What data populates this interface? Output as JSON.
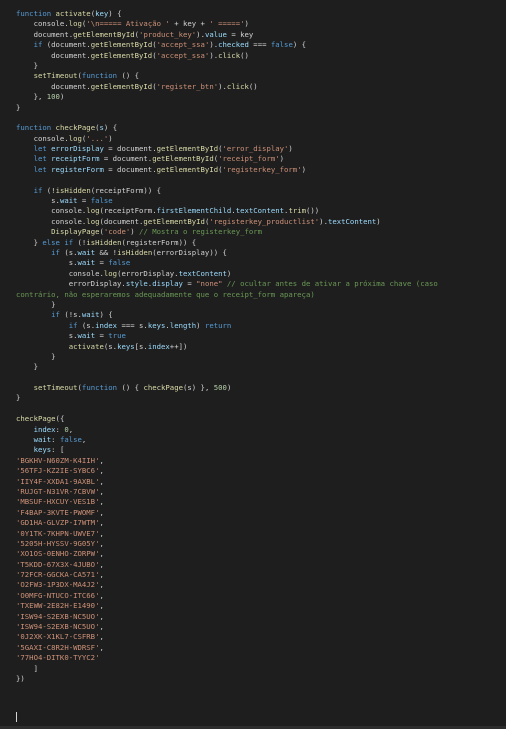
{
  "editor": {
    "language": "javascript",
    "colors": {
      "background": "#1e1e1e",
      "keyword": "#569cd6",
      "function": "#dcdcaa",
      "string": "#ce9178",
      "variable": "#9cdcfe",
      "number": "#b5cea8",
      "comment": "#6a9955",
      "plain": "#d4d4d4"
    },
    "lines": [
      [
        [
          "kw",
          "function "
        ],
        [
          "fn",
          "activate"
        ],
        [
          "pun",
          "("
        ],
        [
          "var",
          "key"
        ],
        [
          "pun",
          ") {"
        ]
      ],
      [
        [
          "plain",
          "    console."
        ],
        [
          "fn",
          "log"
        ],
        [
          "pun",
          "("
        ],
        [
          "str",
          "'\\n===== Ativação '"
        ],
        [
          "pun",
          " + key + "
        ],
        [
          "str",
          "' ====='"
        ],
        [
          "pun",
          ")"
        ]
      ],
      [
        [
          "plain",
          "    document."
        ],
        [
          "fn",
          "getElementById"
        ],
        [
          "pun",
          "("
        ],
        [
          "str",
          "'product_key'"
        ],
        [
          "pun",
          ")."
        ],
        [
          "var",
          "value"
        ],
        [
          "pun",
          " = key"
        ]
      ],
      [
        [
          "kw",
          "    if "
        ],
        [
          "pun",
          "(document."
        ],
        [
          "fn",
          "getElementById"
        ],
        [
          "pun",
          "("
        ],
        [
          "str",
          "'accept_ssa'"
        ],
        [
          "pun",
          ")."
        ],
        [
          "var",
          "checked"
        ],
        [
          "pun",
          " === "
        ],
        [
          "kw",
          "false"
        ],
        [
          "pun",
          ") {"
        ]
      ],
      [
        [
          "plain",
          "        document."
        ],
        [
          "fn",
          "getElementById"
        ],
        [
          "pun",
          "("
        ],
        [
          "str",
          "'accept_ssa'"
        ],
        [
          "pun",
          ")."
        ],
        [
          "fn",
          "click"
        ],
        [
          "pun",
          "()"
        ]
      ],
      [
        [
          "pun",
          "    }"
        ]
      ],
      [
        [
          "plain",
          "    "
        ],
        [
          "fn",
          "setTimeout"
        ],
        [
          "pun",
          "("
        ],
        [
          "kw",
          "function"
        ],
        [
          "pun",
          " () {"
        ]
      ],
      [
        [
          "plain",
          "        document."
        ],
        [
          "fn",
          "getElementById"
        ],
        [
          "pun",
          "("
        ],
        [
          "str",
          "'register_btn'"
        ],
        [
          "pun",
          ")."
        ],
        [
          "fn",
          "click"
        ],
        [
          "pun",
          "()"
        ]
      ],
      [
        [
          "pun",
          "    }, "
        ],
        [
          "num",
          "100"
        ],
        [
          "pun",
          ")"
        ]
      ],
      [
        [
          "pun",
          "}"
        ]
      ],
      [
        [
          "plain",
          ""
        ]
      ],
      [
        [
          "kw",
          "function "
        ],
        [
          "fn",
          "checkPage"
        ],
        [
          "pun",
          "("
        ],
        [
          "var",
          "s"
        ],
        [
          "pun",
          ") {"
        ]
      ],
      [
        [
          "plain",
          "    console."
        ],
        [
          "fn",
          "log"
        ],
        [
          "pun",
          "("
        ],
        [
          "str",
          "'...'"
        ],
        [
          "pun",
          ")"
        ]
      ],
      [
        [
          "kw",
          "    let "
        ],
        [
          "var",
          "errorDisplay"
        ],
        [
          "pun",
          " = document."
        ],
        [
          "fn",
          "getElementById"
        ],
        [
          "pun",
          "("
        ],
        [
          "str",
          "'error_display'"
        ],
        [
          "pun",
          ")"
        ]
      ],
      [
        [
          "kw",
          "    let "
        ],
        [
          "var",
          "receiptForm"
        ],
        [
          "pun",
          " = document."
        ],
        [
          "fn",
          "getElementById"
        ],
        [
          "pun",
          "("
        ],
        [
          "str",
          "'receipt_form'"
        ],
        [
          "pun",
          ")"
        ]
      ],
      [
        [
          "kw",
          "    let "
        ],
        [
          "var",
          "registerForm"
        ],
        [
          "pun",
          " = document."
        ],
        [
          "fn",
          "getElementById"
        ],
        [
          "pun",
          "("
        ],
        [
          "str",
          "'registerkey_form'"
        ],
        [
          "pun",
          ")"
        ]
      ],
      [
        [
          "plain",
          ""
        ]
      ],
      [
        [
          "kw",
          "    if "
        ],
        [
          "pun",
          "(!"
        ],
        [
          "fn",
          "isHidden"
        ],
        [
          "pun",
          "(receiptForm)) {"
        ]
      ],
      [
        [
          "plain",
          "        s."
        ],
        [
          "var",
          "wait"
        ],
        [
          "pun",
          " = "
        ],
        [
          "kw",
          "false"
        ]
      ],
      [
        [
          "plain",
          "        console."
        ],
        [
          "fn",
          "log"
        ],
        [
          "pun",
          "(receiptForm."
        ],
        [
          "var",
          "firstElementChild"
        ],
        [
          "pun",
          "."
        ],
        [
          "var",
          "textContent"
        ],
        [
          "pun",
          "."
        ],
        [
          "fn",
          "trim"
        ],
        [
          "pun",
          "())"
        ]
      ],
      [
        [
          "plain",
          "        console."
        ],
        [
          "fn",
          "log"
        ],
        [
          "pun",
          "(document."
        ],
        [
          "fn",
          "getElementById"
        ],
        [
          "pun",
          "("
        ],
        [
          "str",
          "'registerkey_productlist'"
        ],
        [
          "pun",
          ")."
        ],
        [
          "var",
          "textContent"
        ],
        [
          "pun",
          ")"
        ]
      ],
      [
        [
          "plain",
          "        "
        ],
        [
          "fn",
          "DisplayPage"
        ],
        [
          "pun",
          "("
        ],
        [
          "str",
          "'code'"
        ],
        [
          "pun",
          ") "
        ],
        [
          "cmt",
          "// Mostra o registerkey_form"
        ]
      ],
      [
        [
          "pun",
          "    } "
        ],
        [
          "kw",
          "else if "
        ],
        [
          "pun",
          "(!"
        ],
        [
          "fn",
          "isHidden"
        ],
        [
          "pun",
          "(registerForm)) {"
        ]
      ],
      [
        [
          "kw",
          "        if "
        ],
        [
          "pun",
          "(s."
        ],
        [
          "var",
          "wait"
        ],
        [
          "pun",
          " && !"
        ],
        [
          "fn",
          "isHidden"
        ],
        [
          "pun",
          "(errorDisplay)) {"
        ]
      ],
      [
        [
          "plain",
          "            s."
        ],
        [
          "var",
          "wait"
        ],
        [
          "pun",
          " = "
        ],
        [
          "kw",
          "false"
        ]
      ],
      [
        [
          "plain",
          "            console."
        ],
        [
          "fn",
          "log"
        ],
        [
          "pun",
          "(errorDisplay."
        ],
        [
          "var",
          "textContent"
        ],
        [
          "pun",
          ")"
        ]
      ],
      [
        [
          "plain",
          "            errorDisplay."
        ],
        [
          "var",
          "style"
        ],
        [
          "pun",
          "."
        ],
        [
          "var",
          "display"
        ],
        [
          "pun",
          " = "
        ],
        [
          "str",
          "\"none\""
        ],
        [
          "cmt",
          " // ocultar antes de ativar a próxima chave (caso"
        ]
      ],
      [
        [
          "cmt",
          "contrário, não esperaremos adequadamente que o receipt_form apareça)"
        ]
      ],
      [
        [
          "pun",
          "        }"
        ]
      ],
      [
        [
          "kw",
          "        if "
        ],
        [
          "pun",
          "(!s."
        ],
        [
          "var",
          "wait"
        ],
        [
          "pun",
          ") {"
        ]
      ],
      [
        [
          "kw",
          "            if "
        ],
        [
          "pun",
          "(s."
        ],
        [
          "var",
          "index"
        ],
        [
          "pun",
          " === s."
        ],
        [
          "var",
          "keys"
        ],
        [
          "pun",
          "."
        ],
        [
          "var",
          "length"
        ],
        [
          "pun",
          ") "
        ],
        [
          "kw",
          "return"
        ]
      ],
      [
        [
          "plain",
          "            s."
        ],
        [
          "var",
          "wait"
        ],
        [
          "pun",
          " = "
        ],
        [
          "kw",
          "true"
        ]
      ],
      [
        [
          "plain",
          "            "
        ],
        [
          "fn",
          "activate"
        ],
        [
          "pun",
          "(s."
        ],
        [
          "var",
          "keys"
        ],
        [
          "pun",
          "[s."
        ],
        [
          "var",
          "index"
        ],
        [
          "pun",
          "++])"
        ]
      ],
      [
        [
          "pun",
          "        }"
        ]
      ],
      [
        [
          "pun",
          "    }"
        ]
      ],
      [
        [
          "plain",
          ""
        ]
      ],
      [
        [
          "plain",
          "    "
        ],
        [
          "fn",
          "setTimeout"
        ],
        [
          "pun",
          "("
        ],
        [
          "kw",
          "function"
        ],
        [
          "pun",
          " () { "
        ],
        [
          "fn",
          "checkPage"
        ],
        [
          "pun",
          "(s) }, "
        ],
        [
          "num",
          "500"
        ],
        [
          "pun",
          ")"
        ]
      ],
      [
        [
          "pun",
          "}"
        ]
      ],
      [
        [
          "plain",
          ""
        ]
      ],
      [
        [
          "fn",
          "checkPage"
        ],
        [
          "pun",
          "({"
        ]
      ],
      [
        [
          "plain",
          "    "
        ],
        [
          "var",
          "index"
        ],
        [
          "pun",
          ": "
        ],
        [
          "num",
          "0"
        ],
        [
          "pun",
          ","
        ]
      ],
      [
        [
          "plain",
          "    "
        ],
        [
          "var",
          "wait"
        ],
        [
          "pun",
          ": "
        ],
        [
          "kw",
          "false"
        ],
        [
          "pun",
          ","
        ]
      ],
      [
        [
          "plain",
          "    "
        ],
        [
          "var",
          "keys"
        ],
        [
          "pun",
          ": ["
        ]
      ],
      [
        [
          "str",
          "'BGKHV-N60ZM-K4IIH'"
        ],
        [
          "pun",
          ","
        ]
      ],
      [
        [
          "str",
          "'56TFJ-KZ2IE-SYBC6'"
        ],
        [
          "pun",
          ","
        ]
      ],
      [
        [
          "str",
          "'IIY4F-XXDA1-9AXBL'"
        ],
        [
          "pun",
          ","
        ]
      ],
      [
        [
          "str",
          "'RUJGT-N31VR-7CBVW'"
        ],
        [
          "pun",
          ","
        ]
      ],
      [
        [
          "str",
          "'MBSUF-HXCUY-VES1B'"
        ],
        [
          "pun",
          ","
        ]
      ],
      [
        [
          "str",
          "'F4BAP-3KVTE-PWOMF'"
        ],
        [
          "pun",
          ","
        ]
      ],
      [
        [
          "str",
          "'GD1HA-GLVZP-I7WTM'"
        ],
        [
          "pun",
          ","
        ]
      ],
      [
        [
          "str",
          "'0Y1TK-7KHPN-UWVE7'"
        ],
        [
          "pun",
          ","
        ]
      ],
      [
        [
          "str",
          "'5205H-HYSSV-9G05Y'"
        ],
        [
          "pun",
          ","
        ]
      ],
      [
        [
          "str",
          "'XO1OS-0ENHO-ZORPW'"
        ],
        [
          "pun",
          ","
        ]
      ],
      [
        [
          "str",
          "'T5KDD-67X3X-4JUBO'"
        ],
        [
          "pun",
          ","
        ]
      ],
      [
        [
          "str",
          "'72FCR-GGCKA-CA571'"
        ],
        [
          "pun",
          ","
        ]
      ],
      [
        [
          "str",
          "'O2FW3-1P3DX-MA4J2'"
        ],
        [
          "pun",
          ","
        ]
      ],
      [
        [
          "str",
          "'O0MFG-NTUCO-ITC66'"
        ],
        [
          "pun",
          ","
        ]
      ],
      [
        [
          "str",
          "'TXEWW-2E82H-E1490'"
        ],
        [
          "pun",
          ","
        ]
      ],
      [
        [
          "str",
          "'ISW94-S2EXB-NC5UO'"
        ],
        [
          "pun",
          ","
        ]
      ],
      [
        [
          "str",
          "'ISW94-S2EXB-NC5UO'"
        ],
        [
          "pun",
          ","
        ]
      ],
      [
        [
          "str",
          "'0J2XK-X1KL7-CSFRB'"
        ],
        [
          "pun",
          ","
        ]
      ],
      [
        [
          "str",
          "'5GAXI-C8R2H-WDRSF'"
        ],
        [
          "pun",
          ","
        ]
      ],
      [
        [
          "str",
          "'77HO4-DITK0-TYYC2'"
        ]
      ],
      [
        [
          "pun",
          "    ]"
        ]
      ],
      [
        [
          "pun",
          "})"
        ]
      ]
    ]
  }
}
